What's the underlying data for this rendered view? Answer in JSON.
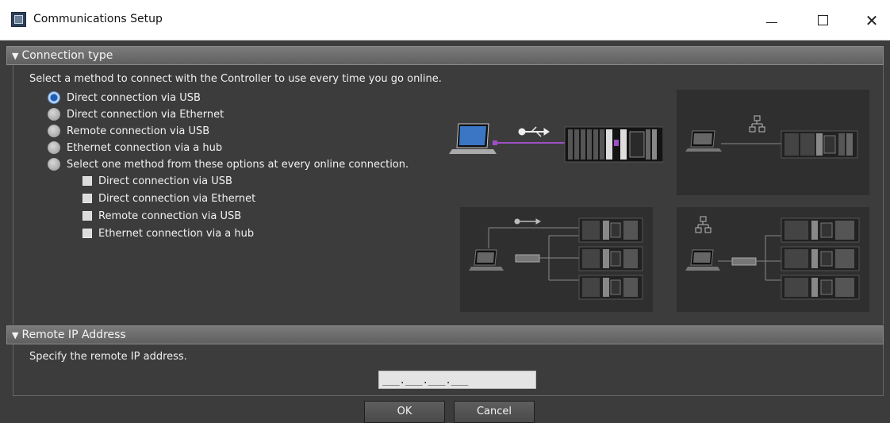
{
  "window": {
    "title": "Communications Setup",
    "minimize_icon": "minimize-icon",
    "maximize_icon": "maximize-icon",
    "close_icon": "close-icon"
  },
  "connection_type": {
    "header": "Connection type",
    "instruction": "Select a method to connect with the Controller to use every time you go online.",
    "options": [
      {
        "label": "Direct connection via USB",
        "selected": true
      },
      {
        "label": "Direct connection via Ethernet",
        "selected": false
      },
      {
        "label": "Remote connection via USB",
        "selected": false
      },
      {
        "label": "Ethernet connection via a hub",
        "selected": false
      },
      {
        "label": "Select one method from these options at every online connection.",
        "selected": false
      }
    ],
    "sub_options": [
      {
        "label": "Direct connection via USB",
        "checked": true
      },
      {
        "label": "Direct connection via Ethernet",
        "checked": true
      },
      {
        "label": "Remote connection via USB",
        "checked": true
      },
      {
        "label": "Ethernet connection via a hub",
        "checked": true
      }
    ],
    "diagram_icons": [
      "laptop-icon",
      "usb-icon",
      "network-icon",
      "controller-icon",
      "hub-icon"
    ]
  },
  "remote_ip": {
    "header": "Remote IP Address",
    "instruction": "Specify the remote IP address.",
    "value": "___.___.___.___"
  },
  "buttons": {
    "ok": "OK",
    "cancel": "Cancel"
  },
  "colors": {
    "dialog_bg": "#3c3c3c",
    "panel_bg": "#2f2f2f",
    "usb_link": "#9d4fc5",
    "selected_radio": "#1c5fb4"
  }
}
